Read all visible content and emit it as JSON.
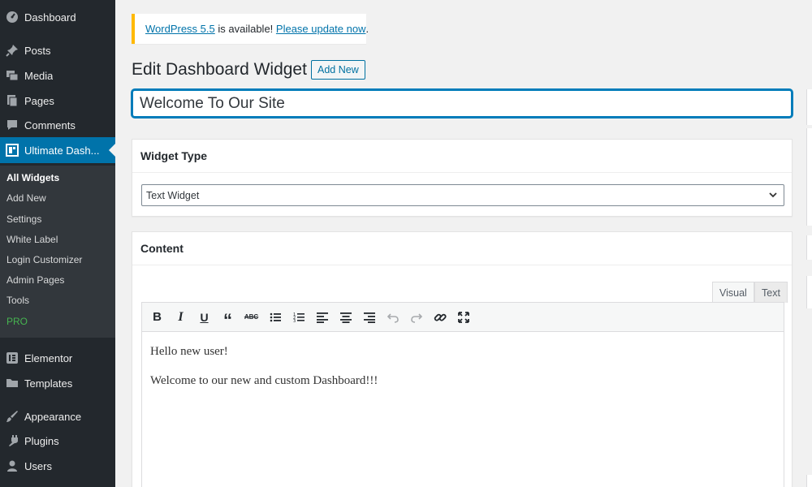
{
  "sidebar": {
    "items": [
      {
        "label": "Dashboard",
        "icon": "dashboard-icon"
      },
      {
        "label": "Posts",
        "icon": "pin-icon"
      },
      {
        "label": "Media",
        "icon": "media-icon"
      },
      {
        "label": "Pages",
        "icon": "pages-icon"
      },
      {
        "label": "Comments",
        "icon": "comments-icon"
      },
      {
        "label": "Ultimate Dash...",
        "icon": "widget-icon",
        "active": true
      },
      {
        "label": "Elementor",
        "icon": "elementor-icon"
      },
      {
        "label": "Templates",
        "icon": "folder-icon"
      },
      {
        "label": "Appearance",
        "icon": "brush-icon"
      },
      {
        "label": "Plugins",
        "icon": "plug-icon"
      },
      {
        "label": "Users",
        "icon": "user-icon"
      }
    ],
    "submenu": [
      "All Widgets",
      "Add New",
      "Settings",
      "White Label",
      "Login Customizer",
      "Admin Pages",
      "Tools",
      "PRO"
    ],
    "active_color": "#0073aa",
    "pro_color": "#46b450"
  },
  "notice": {
    "link1": "WordPress 5.5",
    "middle": " is available! ",
    "link2": "Please update now",
    "end": ".",
    "border_color": "#ffb900"
  },
  "header": {
    "title": "Edit Dashboard Widget",
    "add_new": "Add New"
  },
  "title_input": {
    "value": "Welcome To Our Site"
  },
  "widget_type": {
    "heading": "Widget Type",
    "selected": "Text Widget"
  },
  "content": {
    "heading": "Content",
    "tabs": [
      "Visual",
      "Text"
    ],
    "toolbar": [
      "bold-icon",
      "italic-icon",
      "underline-icon",
      "blockquote-icon",
      "strikethrough-icon",
      "bullet-list-icon",
      "numbered-list-icon",
      "align-left-icon",
      "align-center-icon",
      "align-right-icon",
      "undo-icon",
      "redo-icon",
      "link-icon",
      "fullscreen-icon"
    ],
    "paragraphs": [
      "Hello new user!",
      "Welcome to our new and custom Dashboard!!!"
    ]
  }
}
